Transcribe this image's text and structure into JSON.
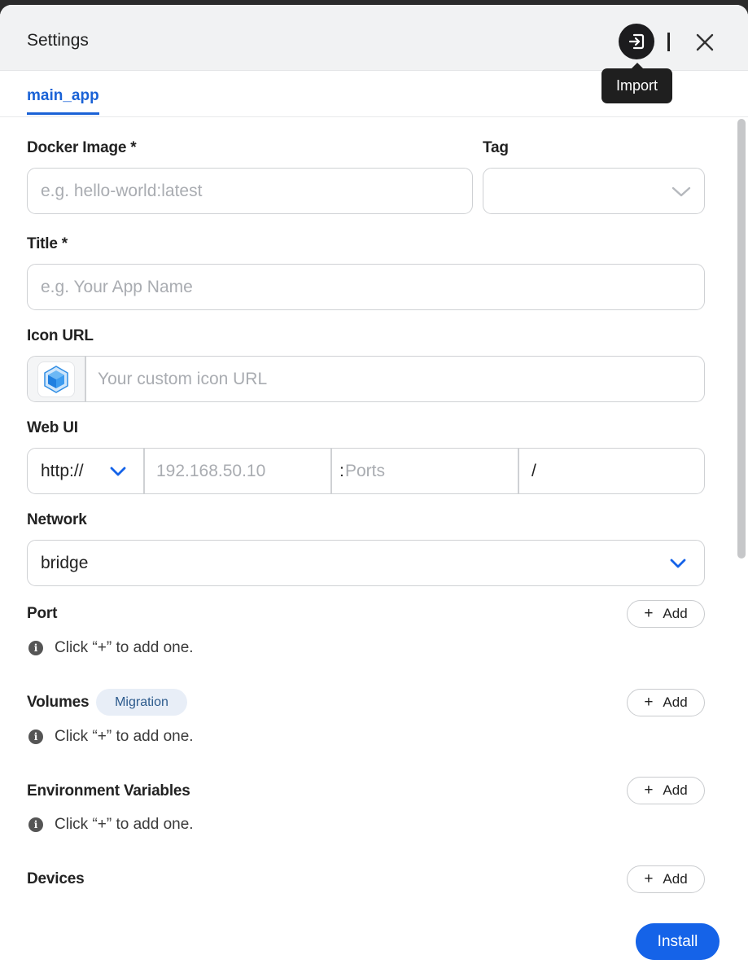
{
  "header": {
    "title": "Settings",
    "import_tooltip": "Import"
  },
  "tabs": [
    {
      "label": "main_app",
      "active": true
    }
  ],
  "form": {
    "docker_image": {
      "label": "Docker Image *",
      "placeholder": "e.g. hello-world:latest",
      "value": ""
    },
    "tag": {
      "label": "Tag",
      "value": ""
    },
    "title": {
      "label": "Title *",
      "placeholder": "e.g. Your App Name",
      "value": ""
    },
    "icon_url": {
      "label": "Icon URL",
      "placeholder": "Your custom icon URL",
      "value": ""
    },
    "web_ui": {
      "label": "Web UI",
      "protocol": "http://",
      "host_placeholder": "192.168.50.10",
      "port_prefix": ":",
      "port_placeholder": "Ports",
      "path": "/"
    },
    "network": {
      "label": "Network",
      "value": "bridge"
    }
  },
  "sections": {
    "port": {
      "label": "Port",
      "add_label": "Add",
      "hint": "Click “+” to add one."
    },
    "volumes": {
      "label": "Volumes",
      "badge": "Migration",
      "add_label": "Add",
      "hint": "Click “+” to add one."
    },
    "env": {
      "label": "Environment Variables",
      "add_label": "Add",
      "hint": "Click “+” to add one."
    },
    "devices": {
      "label": "Devices",
      "add_label": "Add"
    }
  },
  "footer": {
    "install_label": "Install"
  },
  "colors": {
    "accent": "#1563e8",
    "tab_active": "#1a62d6",
    "badge_bg": "#e8eef7"
  }
}
